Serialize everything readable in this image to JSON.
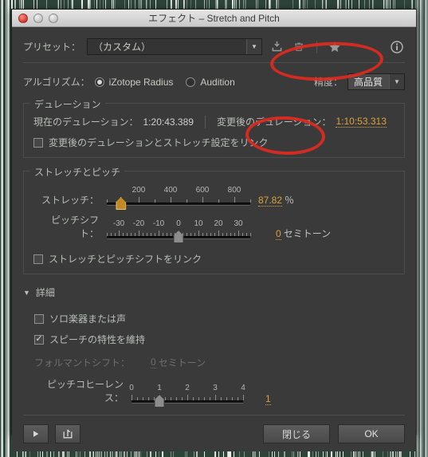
{
  "window": {
    "title": "エフェクト – Stretch and Pitch",
    "traffic_lights": [
      "close-button",
      "minimize-button",
      "zoom-button"
    ]
  },
  "preset": {
    "label": "プリセット：",
    "value": "（カスタム）",
    "icons": {
      "save": "save-preset-icon",
      "delete": "delete-preset-icon",
      "favorite": "favorite-star-icon",
      "info": "info-icon"
    }
  },
  "algorithm": {
    "label": "アルゴリズム：",
    "options": [
      {
        "label": "iZotope Radius",
        "selected": true
      },
      {
        "label": "Audition",
        "selected": false
      }
    ],
    "precision_label": "精度：",
    "precision_value": "高品質"
  },
  "duration": {
    "title": "デュレーション",
    "current_label": "現在のデュレーション：",
    "current_value": "1:20:43.389",
    "new_label": "変更後のデュレーション：",
    "new_value": "1:10:53.313",
    "link_checkbox": {
      "label": "変更後のデュレーションとストレッチ設定をリンク",
      "checked": false
    }
  },
  "stretch_pitch": {
    "title": "ストレッチとピッチ",
    "stretch": {
      "label": "ストレッチ：",
      "value": "87.82",
      "unit": "％",
      "ticks": [
        200,
        400,
        600,
        800
      ],
      "min": 0,
      "max": 900,
      "thumb": 87.82
    },
    "pitch_shift": {
      "label": "ピッチシフト：",
      "value": "0",
      "unit": "セミトーン",
      "ticks": [
        -30,
        -20,
        -10,
        0,
        10,
        20,
        30
      ],
      "min": -36,
      "max": 36,
      "thumb": 0
    },
    "link_checkbox": {
      "label": "ストレッチとピッチシフトをリンク",
      "checked": false
    }
  },
  "details": {
    "title": "詳細",
    "expanded": true,
    "solo_checkbox": {
      "label": "ソロ楽器または声",
      "checked": false
    },
    "speech_checkbox": {
      "label": "スピーチの特性を維持",
      "checked": true
    },
    "formant": {
      "label": "フォルマントシフト：",
      "value": "0",
      "unit": "セミトーン",
      "disabled": true
    },
    "coherence": {
      "label": "ピッチコヒーレンス：",
      "value": "1",
      "ticks": [
        0,
        1,
        2,
        3,
        4
      ],
      "min": 0,
      "max": 4,
      "thumb": 1
    }
  },
  "footer": {
    "preview_icon": "play-icon",
    "power_icon": "toggle-power-icon",
    "close_label": "閉じる",
    "ok_label": "OK"
  },
  "colors": {
    "accent": "#d9a23c",
    "annotation": "#e02a20",
    "window_bg": "#3a3a3a",
    "waveform_bg": "#2d443b"
  }
}
